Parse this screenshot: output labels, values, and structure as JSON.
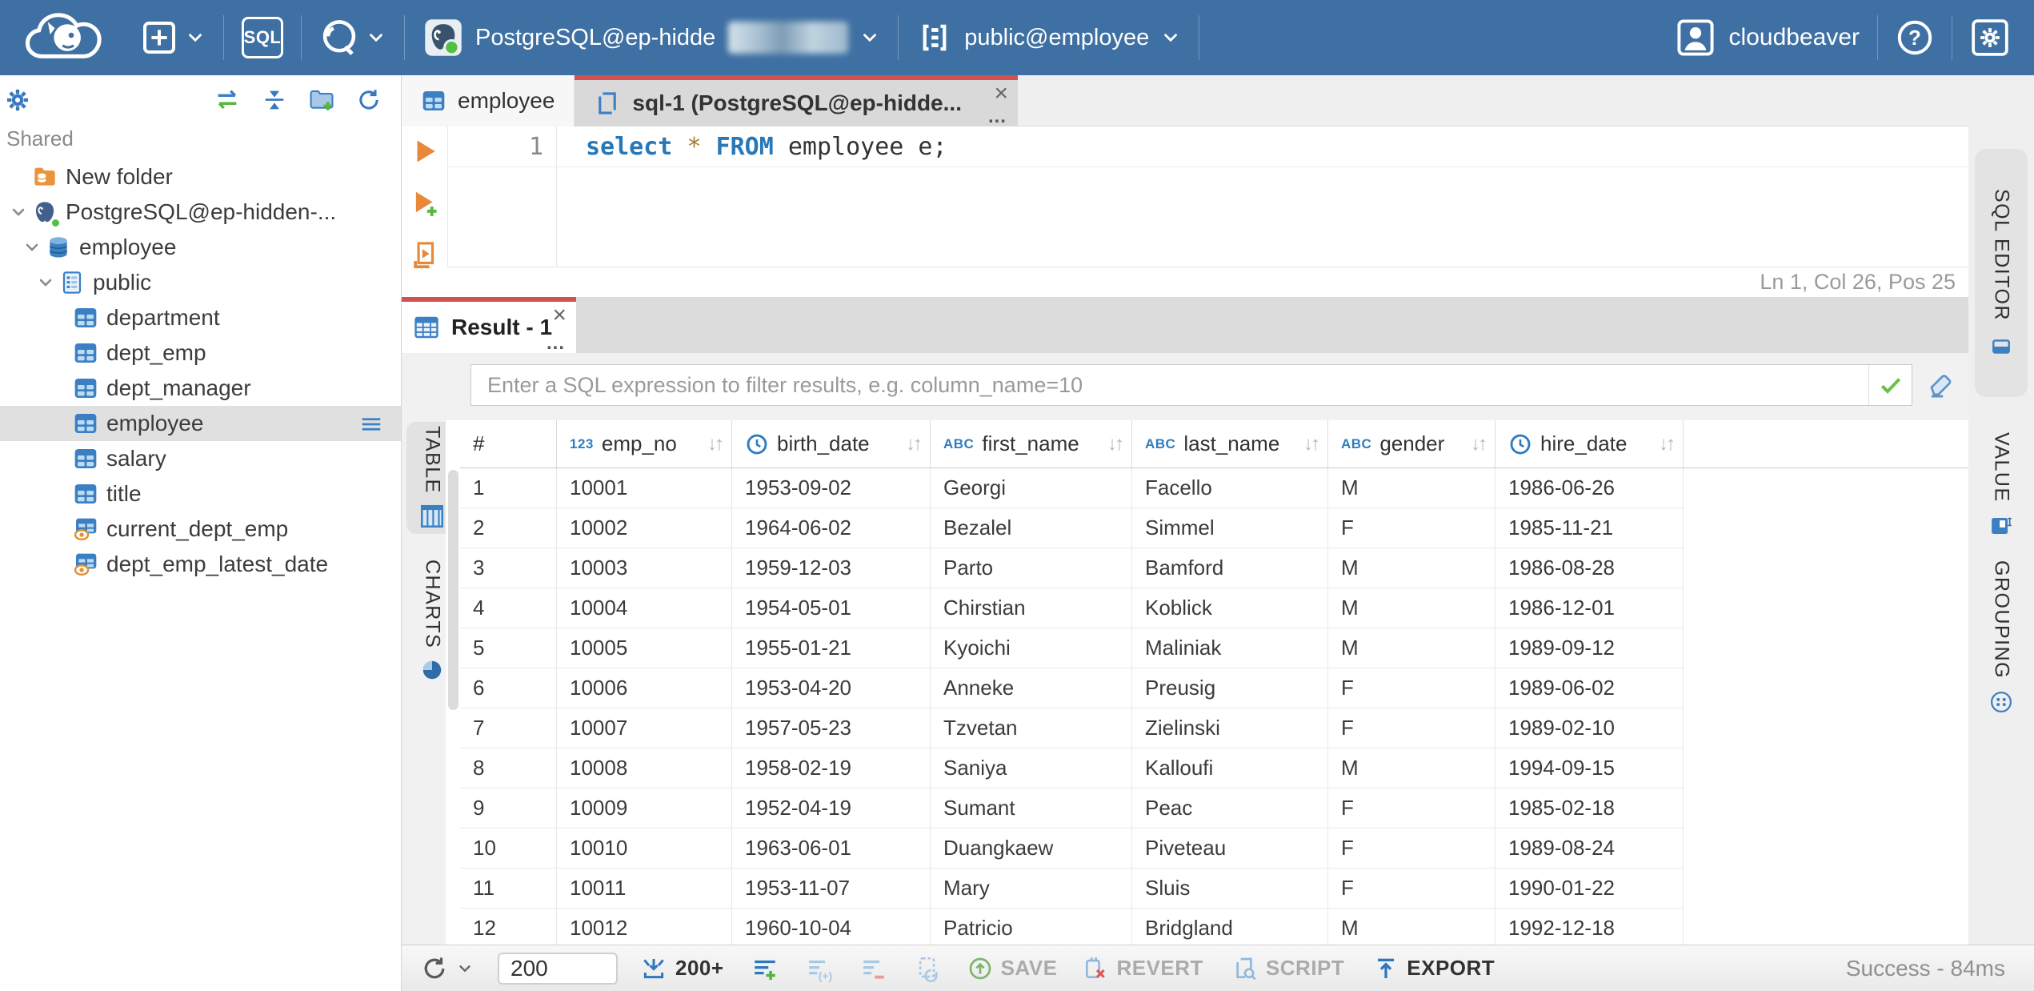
{
  "header": {
    "sql_button": "SQL",
    "connection_label": "PostgreSQL@ep-hidde",
    "schema_label": "public@employee",
    "user_label": "cloudbeaver"
  },
  "sidebar": {
    "section_label": "Shared",
    "tree": [
      {
        "label": "New folder",
        "icon": "folder-db",
        "depth": 0
      },
      {
        "label": "PostgreSQL@ep-hidden-...",
        "icon": "postgres",
        "depth": 0,
        "chevron": true
      },
      {
        "label": "employee",
        "icon": "database",
        "depth": 1,
        "chevron": true
      },
      {
        "label": "public",
        "icon": "schema",
        "depth": 2,
        "chevron": true
      },
      {
        "label": "department",
        "icon": "table",
        "depth": 3
      },
      {
        "label": "dept_emp",
        "icon": "table",
        "depth": 3
      },
      {
        "label": "dept_manager",
        "icon": "table",
        "depth": 3
      },
      {
        "label": "employee",
        "icon": "table",
        "depth": 3,
        "selected": true,
        "menu": true
      },
      {
        "label": "salary",
        "icon": "table",
        "depth": 3
      },
      {
        "label": "title",
        "icon": "table",
        "depth": 3
      },
      {
        "label": "current_dept_emp",
        "icon": "view",
        "depth": 3
      },
      {
        "label": "dept_emp_latest_date",
        "icon": "view",
        "depth": 3
      }
    ]
  },
  "editor_tabs": [
    {
      "label": "employee",
      "icon": "table",
      "active": false
    },
    {
      "label": "sql-1 (PostgreSQL@ep-hidde...",
      "icon": "sql-script",
      "active": true,
      "close": "×",
      "ellipsis": "..."
    }
  ],
  "editor": {
    "line_number": "1",
    "sql_tokens": [
      {
        "text": "select",
        "type": "keyword"
      },
      {
        "text": " ",
        "type": "plain"
      },
      {
        "text": "*",
        "type": "star"
      },
      {
        "text": " ",
        "type": "plain"
      },
      {
        "text": "FROM",
        "type": "keyword"
      },
      {
        "text": " employee e;",
        "type": "plain"
      }
    ],
    "status": "Ln 1, Col 26, Pos 25"
  },
  "right_panel_tabs": [
    {
      "label": "SQL EDITOR"
    },
    {
      "label": "VALUE"
    },
    {
      "label": "GROUPING"
    }
  ],
  "result": {
    "tab_label": "Result - 1",
    "close": "×",
    "ellipsis": "...",
    "filter_placeholder": "Enter a SQL expression to filter results, e.g. column_name=10",
    "side_tabs_left": [
      {
        "label": "TABLE"
      },
      {
        "label": "CHARTS"
      }
    ]
  },
  "grid": {
    "columns": [
      {
        "label": "#",
        "type": "rownum"
      },
      {
        "label": "emp_no",
        "type": "number"
      },
      {
        "label": "birth_date",
        "type": "date"
      },
      {
        "label": "first_name",
        "type": "text"
      },
      {
        "label": "last_name",
        "type": "text"
      },
      {
        "label": "gender",
        "type": "text"
      },
      {
        "label": "hire_date",
        "type": "date"
      }
    ],
    "rows": [
      [
        "1",
        "10001",
        "1953-09-02",
        "Georgi",
        "Facello",
        "M",
        "1986-06-26"
      ],
      [
        "2",
        "10002",
        "1964-06-02",
        "Bezalel",
        "Simmel",
        "F",
        "1985-11-21"
      ],
      [
        "3",
        "10003",
        "1959-12-03",
        "Parto",
        "Bamford",
        "M",
        "1986-08-28"
      ],
      [
        "4",
        "10004",
        "1954-05-01",
        "Chirstian",
        "Koblick",
        "M",
        "1986-12-01"
      ],
      [
        "5",
        "10005",
        "1955-01-21",
        "Kyoichi",
        "Maliniak",
        "M",
        "1989-09-12"
      ],
      [
        "6",
        "10006",
        "1953-04-20",
        "Anneke",
        "Preusig",
        "F",
        "1989-06-02"
      ],
      [
        "7",
        "10007",
        "1957-05-23",
        "Tzvetan",
        "Zielinski",
        "F",
        "1989-02-10"
      ],
      [
        "8",
        "10008",
        "1958-02-19",
        "Saniya",
        "Kalloufi",
        "M",
        "1994-09-15"
      ],
      [
        "9",
        "10009",
        "1952-04-19",
        "Sumant",
        "Peac",
        "F",
        "1985-02-18"
      ],
      [
        "10",
        "10010",
        "1963-06-01",
        "Duangkaew",
        "Piveteau",
        "F",
        "1989-08-24"
      ],
      [
        "11",
        "10011",
        "1953-11-07",
        "Mary",
        "Sluis",
        "F",
        "1990-01-22"
      ],
      [
        "12",
        "10012",
        "1960-10-04",
        "Patricio",
        "Bridgland",
        "M",
        "1992-12-18"
      ]
    ]
  },
  "toolbar": {
    "fetch_size": "200",
    "fetch_more_label": "200+",
    "save_label": "SAVE",
    "revert_label": "REVERT",
    "script_label": "SCRIPT",
    "export_label": "EXPORT",
    "status": "Success - 84ms"
  },
  "colors": {
    "header_blue": "#3F70A3",
    "accent_blue": "#3C80C4",
    "active_tab_red": "#D25252",
    "exec_orange": "#E8883A",
    "success_green": "#52C041"
  }
}
